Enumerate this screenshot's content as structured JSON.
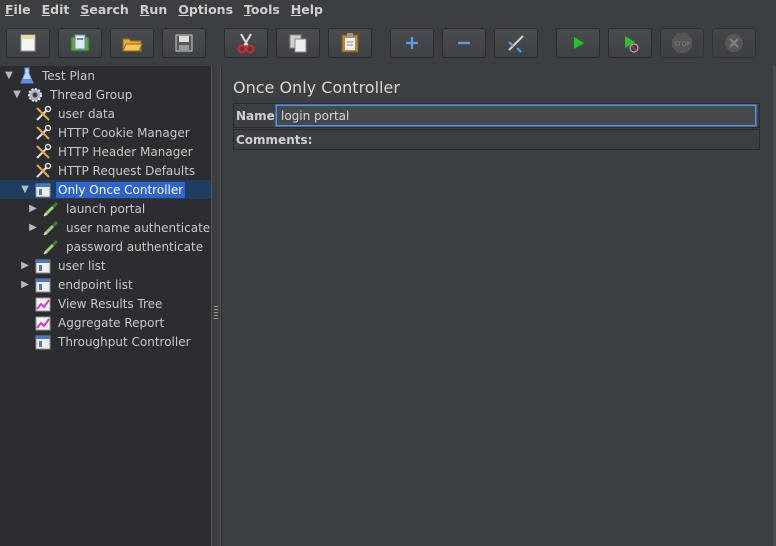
{
  "menubar": {
    "items": [
      {
        "mnemonic": "F",
        "rest": "ile"
      },
      {
        "mnemonic": "E",
        "rest": "dit"
      },
      {
        "mnemonic": "S",
        "rest": "earch"
      },
      {
        "mnemonic": "R",
        "rest": "un"
      },
      {
        "mnemonic": "O",
        "rest": "ptions"
      },
      {
        "mnemonic": "T",
        "rest": "ools"
      },
      {
        "mnemonic": "H",
        "rest": "elp"
      }
    ]
  },
  "toolbar": {
    "buttons": [
      {
        "icon": "new-icon"
      },
      {
        "icon": "templates-icon"
      },
      {
        "icon": "open-icon"
      },
      {
        "icon": "save-icon"
      },
      {
        "icon": "cut-icon"
      },
      {
        "icon": "copy-icon"
      },
      {
        "icon": "paste-icon"
      },
      {
        "icon": "expand-plus-icon"
      },
      {
        "icon": "collapse-minus-icon"
      },
      {
        "icon": "toggle-icon"
      },
      {
        "icon": "start-icon"
      },
      {
        "icon": "start-no-pauses-icon"
      },
      {
        "icon": "stop-icon",
        "text": "STOP"
      },
      {
        "icon": "shutdown-icon"
      }
    ]
  },
  "tree": {
    "nodes": [
      {
        "label": "Test Plan",
        "icon": "test-plan-icon",
        "expander": "expanded"
      },
      {
        "label": "Thread Group",
        "icon": "gear-icon",
        "expander": "expanded"
      },
      {
        "label": "user data",
        "icon": "wrench-icon",
        "expander": "none"
      },
      {
        "label": "HTTP Cookie Manager",
        "icon": "wrench-icon",
        "expander": "none"
      },
      {
        "label": "HTTP Header Manager",
        "icon": "wrench-icon",
        "expander": "none"
      },
      {
        "label": "HTTP Request Defaults",
        "icon": "wrench-icon",
        "expander": "none"
      },
      {
        "label": "Only Once Controller",
        "icon": "controller-icon",
        "expander": "expanded",
        "selected": true
      },
      {
        "label": "launch portal",
        "icon": "pipette-icon",
        "expander": "collapsed"
      },
      {
        "label": "user name authenticate",
        "icon": "pipette-icon",
        "expander": "collapsed"
      },
      {
        "label": "password authenticate",
        "icon": "pipette-icon",
        "expander": "none"
      },
      {
        "label": "user list",
        "icon": "controller-icon",
        "expander": "collapsed"
      },
      {
        "label": "endpoint list",
        "icon": "controller-icon",
        "expander": "collapsed"
      },
      {
        "label": "View Results Tree",
        "icon": "graph-icon",
        "expander": "none"
      },
      {
        "label": "Aggregate Report",
        "icon": "graph-icon",
        "expander": "none"
      },
      {
        "label": "Throughput Controller",
        "icon": "controller-icon",
        "expander": "none"
      }
    ]
  },
  "main": {
    "title": "Once Only Controller",
    "name_label": "Name:",
    "name_value": "login portal",
    "comments_label": "Comments:",
    "comments_value": ""
  },
  "colors": {
    "background": "#3c3f41",
    "tree_background": "#2b2d30",
    "selection": "#2f65ca",
    "run_green": "#27c22c"
  }
}
